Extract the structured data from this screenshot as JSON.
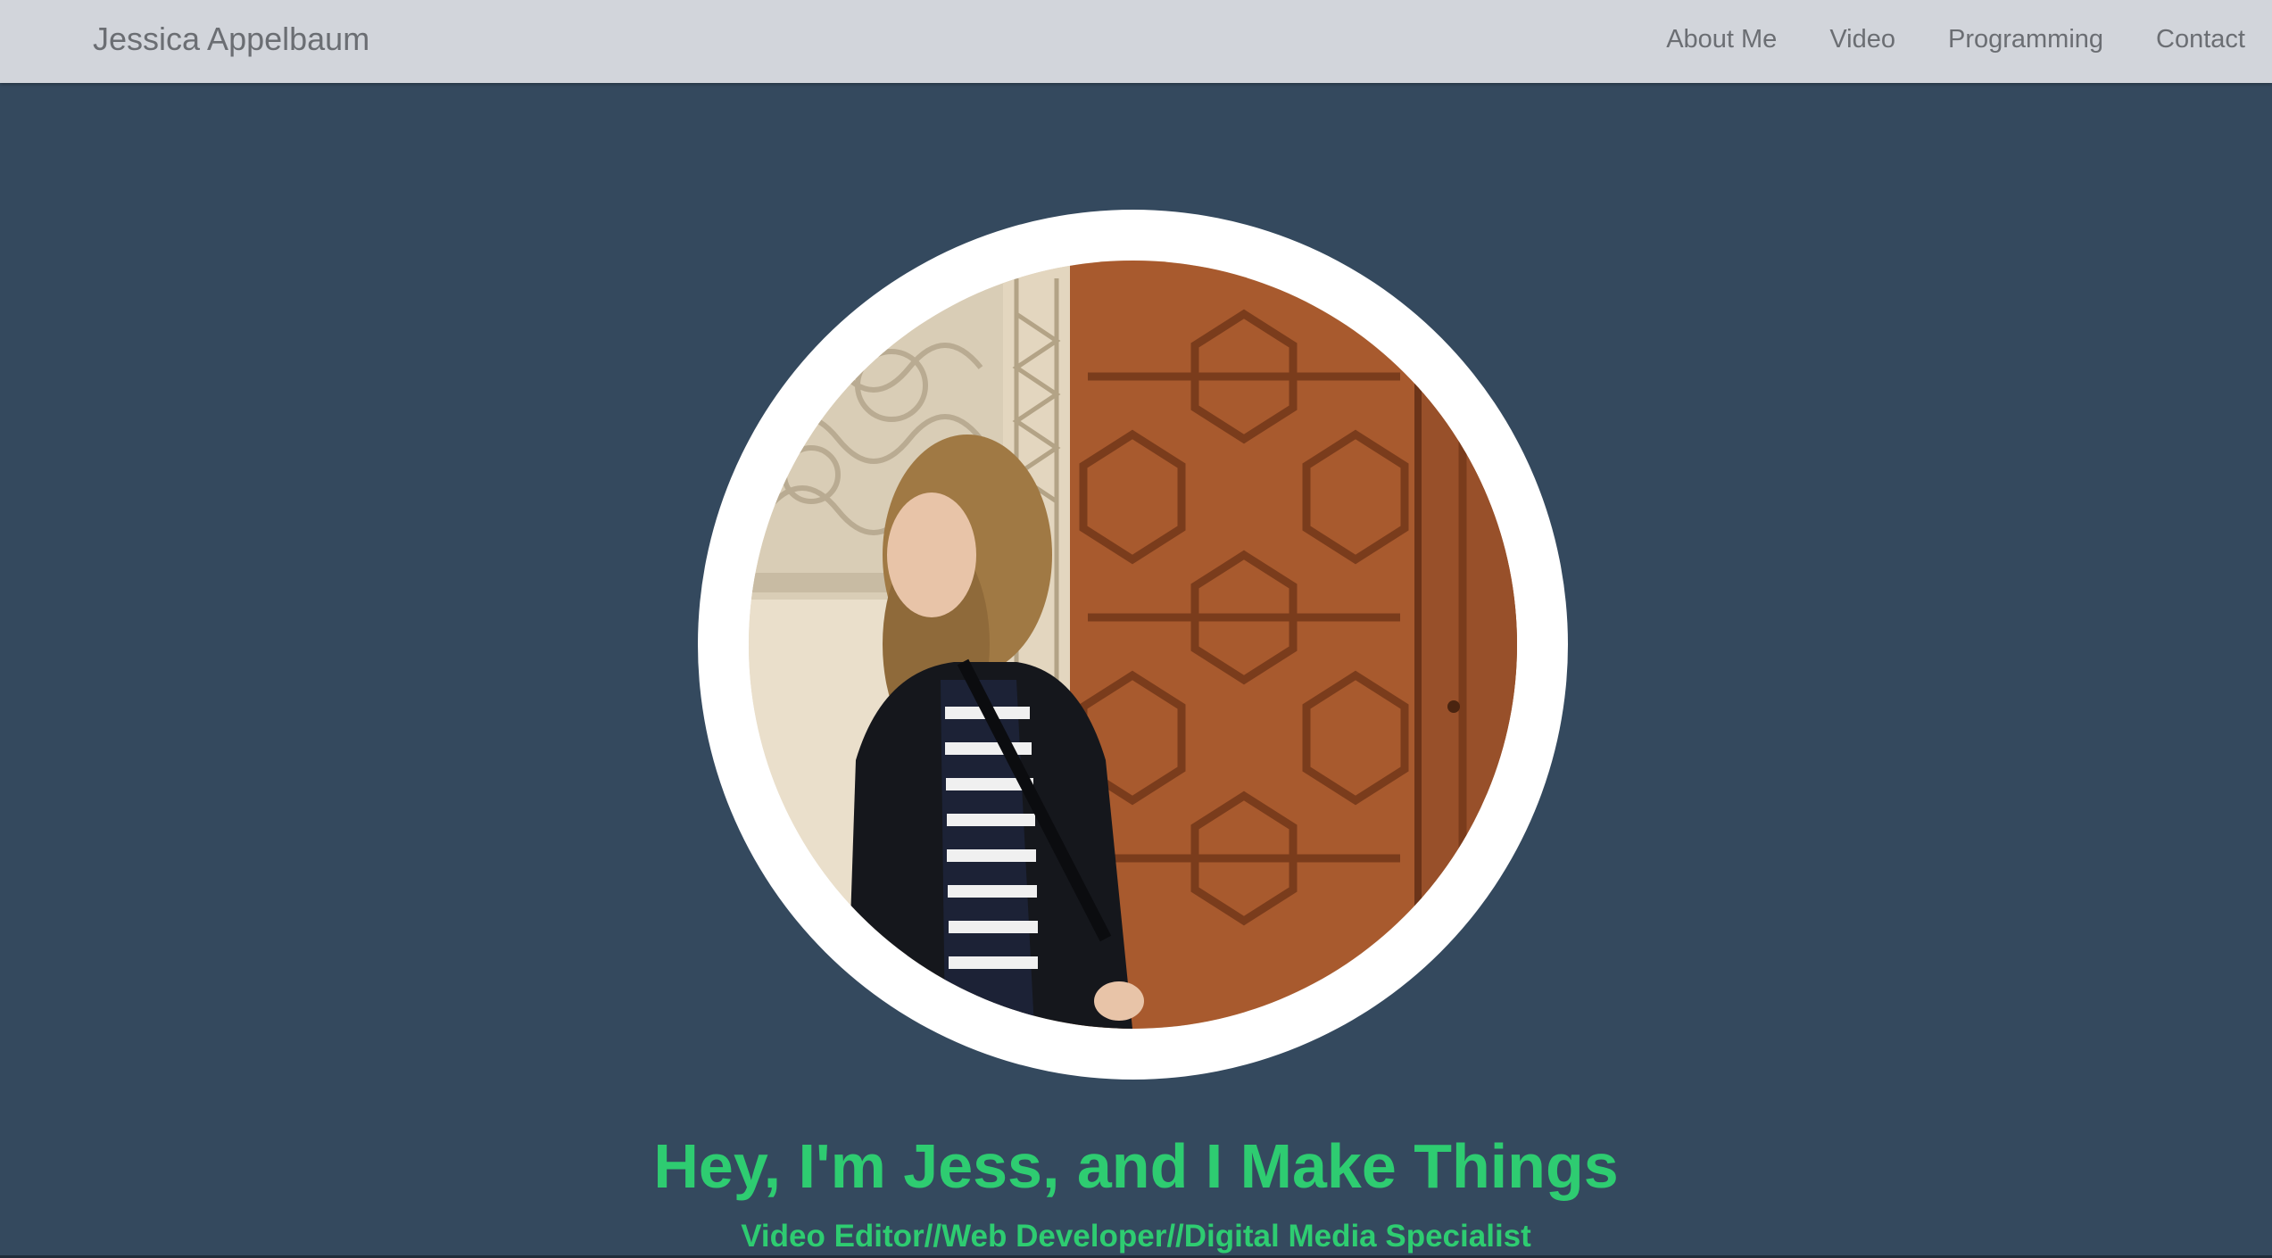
{
  "navbar": {
    "brand": "Jessica Appelbaum",
    "links": [
      {
        "label": "About Me"
      },
      {
        "label": "Video"
      },
      {
        "label": "Programming"
      },
      {
        "label": "Contact"
      }
    ]
  },
  "hero": {
    "headline": "Hey, I'm Jess, and I Make Things",
    "subhead": "Video Editor//Web Developer//Digital Media Specialist"
  },
  "colors": {
    "page_background": "#34495e",
    "navbar_background": "#d2d5db",
    "nav_text": "#6b6e73",
    "accent_green": "#2ecc71",
    "avatar_ring": "#ffffff"
  }
}
